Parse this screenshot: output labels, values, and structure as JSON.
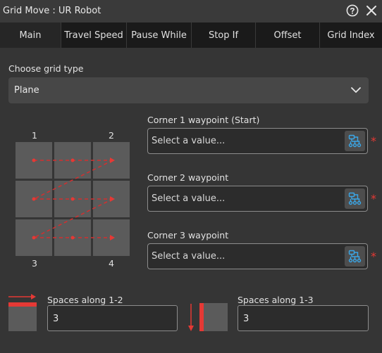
{
  "window": {
    "title": "Grid Move : UR Robot"
  },
  "tabs": [
    {
      "label": "Main"
    },
    {
      "label": "Travel Speed"
    },
    {
      "label": "Pause While"
    },
    {
      "label": "Stop If"
    },
    {
      "label": "Offset"
    },
    {
      "label": "Grid Index"
    }
  ],
  "grid_type": {
    "label": "Choose grid type",
    "value": "Plane"
  },
  "diagram": {
    "corner_labels": [
      "1",
      "2",
      "3",
      "4"
    ]
  },
  "waypoints": [
    {
      "label": "Corner 1 waypoint (Start)",
      "placeholder": "Select a value..."
    },
    {
      "label": "Corner 2 waypoint",
      "placeholder": "Select a value..."
    },
    {
      "label": "Corner 3 waypoint",
      "placeholder": "Select a value..."
    }
  ],
  "required_marker": "*",
  "spaces": {
    "along_1_2": {
      "label": "Spaces along 1-2",
      "value": "3"
    },
    "along_1_3": {
      "label": "Spaces along 1-3",
      "value": "3"
    }
  },
  "colors": {
    "background": "#353535",
    "tab_bar": "#1a1a1a",
    "accent_red": "#e53935",
    "pick_icon_blue": "#3aa7e8"
  },
  "icons": [
    "help-icon",
    "close-icon",
    "chevron-down-icon",
    "waypoint-tree-icon",
    "arrow-right-icon",
    "arrow-down-icon"
  ]
}
